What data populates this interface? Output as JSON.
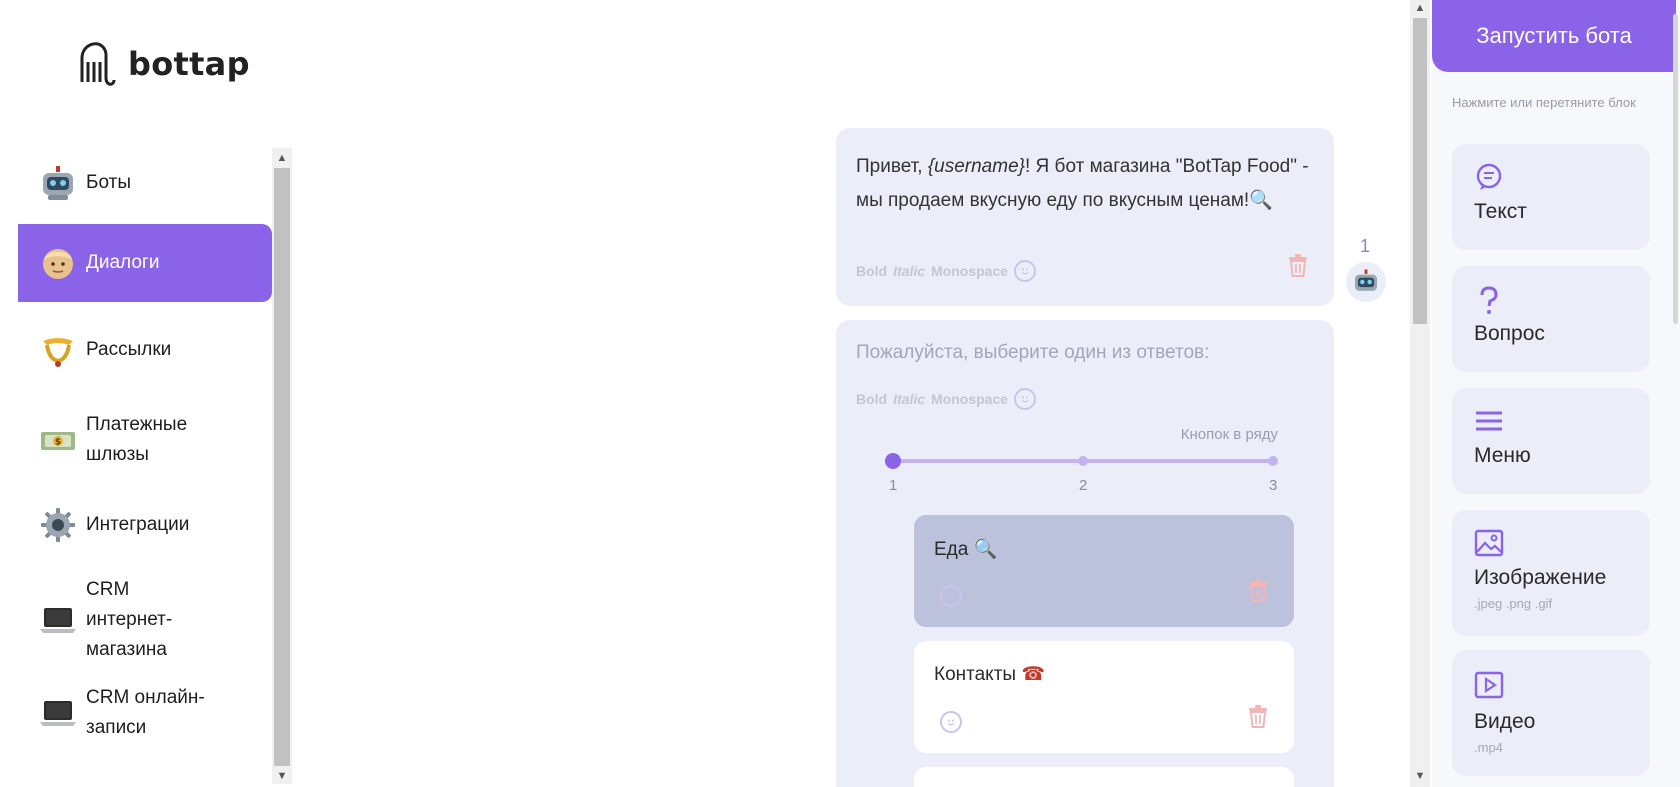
{
  "brand": {
    "name": "bottap"
  },
  "sidebar": {
    "items": [
      {
        "label": "Боты",
        "icon": "robot-icon"
      },
      {
        "label": "Диалоги",
        "icon": "person-face-icon",
        "active": true
      },
      {
        "label": "Рассылки",
        "icon": "postal-horn-icon"
      },
      {
        "label": "Платежные шлюзы",
        "icon": "banknote-icon"
      },
      {
        "label": "Интеграции",
        "icon": "gear-icon"
      },
      {
        "label": "CRM интернет-магазина",
        "icon": "laptop-icon"
      },
      {
        "label": "CRM онлайн-записи",
        "icon": "laptop-icon"
      }
    ]
  },
  "chat": {
    "message": {
      "text_before": "Привет, ",
      "variable": "{username}",
      "text_after": "! Я бот магазина \"BotTap Food\" - мы продаем вкусную еду по вкусным ценам!",
      "emoji": "🔍",
      "index": "1"
    },
    "format": {
      "bold": "Bold",
      "italic": "Italic",
      "mono": "Monospace"
    },
    "question": {
      "placeholder": "Пожалуйста, выберите один из ответов:",
      "buttons_per_row_label": "Кнопок в ряду",
      "buttons_per_row_value": 1,
      "ticks": [
        "1",
        "2",
        "3"
      ],
      "answers": [
        {
          "label": "Еда",
          "emoji": "🔍",
          "selected": true
        },
        {
          "label": "Контакты",
          "emoji": "☎"
        }
      ]
    }
  },
  "right_panel": {
    "launch_label": "Запустить бота",
    "hint": "Нажмите или перетяните блок",
    "blocks": [
      {
        "label": "Текст",
        "icon": "speech-bubble-icon"
      },
      {
        "label": "Вопрос",
        "icon": "question-mark-icon"
      },
      {
        "label": "Меню",
        "icon": "menu-icon"
      },
      {
        "label": "Изображение",
        "sub": ".jpeg .png .gif",
        "icon": "image-icon"
      },
      {
        "label": "Видео",
        "sub": ".mp4",
        "icon": "video-icon"
      }
    ]
  },
  "colors": {
    "accent": "#8b63e9",
    "card": "#ebedf8",
    "selected_answer": "#bcc1dc",
    "trash": "#f1b6b6"
  }
}
